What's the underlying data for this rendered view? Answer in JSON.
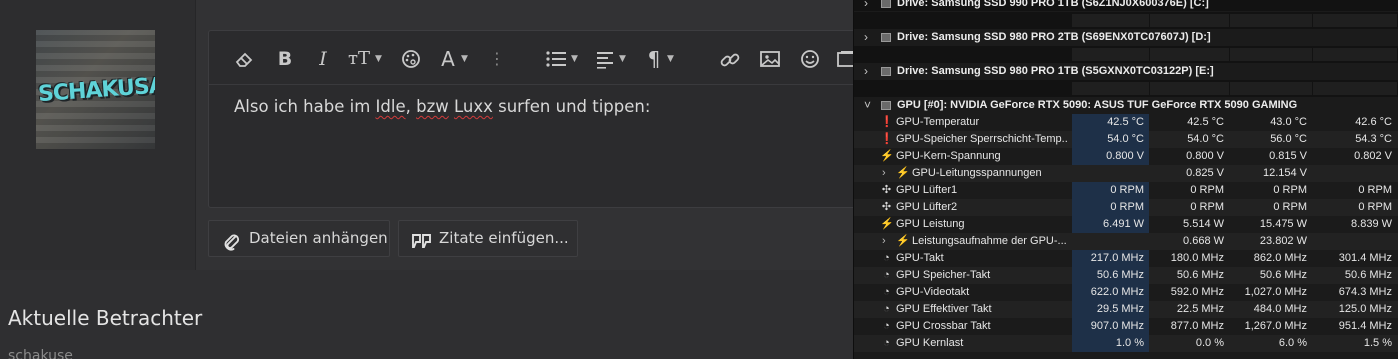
{
  "editor": {
    "text_before": "Also ich habe im ",
    "word_idle": "Idle",
    "text_mid1": ", ",
    "word_bzw": "bzw",
    "text_mid2": " ",
    "word_luxx": "Luxx",
    "text_after": " surfen und tippen:"
  },
  "avatar": {
    "graffiti_text": "SCHAKUSA"
  },
  "buttons": {
    "attach": "Dateien anhängen",
    "quote": "Zitate einfügen..."
  },
  "viewers": {
    "title": "Aktuelle Betrachter",
    "name": "schakuse"
  },
  "hwinfo": {
    "drives": [
      "Drive: Samsung SSD 990 PRO 1TB (S6Z1NJ0X600376E) [C:]",
      "Drive: Samsung SSD 980 PRO 2TB (S69ENX0TC07607J) [D:]",
      "Drive: Samsung SSD 980 PRO 1TB (S5GXNX0TC03122P) [E:]"
    ],
    "gpu_header": "GPU [#0]: NVIDIA GeForce RTX 5090: ASUS TUF GeForce RTX 5090 GAMING",
    "rows": [
      {
        "icon": "thermometer",
        "label": "GPU-Temperatur",
        "v": [
          "42.5 °C",
          "42.5 °C",
          "43.0 °C",
          "42.6 °C"
        ]
      },
      {
        "icon": "thermometer",
        "label": "GPU-Speicher Sperrschicht-Temp...",
        "v": [
          "54.0 °C",
          "54.0 °C",
          "56.0 °C",
          "54.3 °C"
        ]
      },
      {
        "icon": "lightning",
        "label": "GPU-Kern-Spannung",
        "v": [
          "0.800 V",
          "0.800 V",
          "0.815 V",
          "0.802 V"
        ]
      },
      {
        "icon": "lightning",
        "label": "GPU-Leitungsspannungen",
        "expand": true,
        "v": [
          "",
          "0.825 V",
          "12.154 V",
          ""
        ]
      },
      {
        "icon": "fan",
        "label": "GPU Lüfter1",
        "v": [
          "0 RPM",
          "0 RPM",
          "0 RPM",
          "0 RPM"
        ]
      },
      {
        "icon": "fan",
        "label": "GPU Lüfter2",
        "v": [
          "0 RPM",
          "0 RPM",
          "0 RPM",
          "0 RPM"
        ]
      },
      {
        "icon": "lightning",
        "label": "GPU Leistung",
        "v": [
          "6.491 W",
          "5.514 W",
          "15.475 W",
          "8.839 W"
        ]
      },
      {
        "icon": "lightning",
        "label": "Leistungsaufnahme der GPU-...",
        "expand": true,
        "v": [
          "",
          "0.668 W",
          "23.802 W",
          ""
        ]
      },
      {
        "icon": "clock",
        "label": "GPU-Takt",
        "v": [
          "217.0 MHz",
          "180.0 MHz",
          "862.0 MHz",
          "301.4 MHz"
        ]
      },
      {
        "icon": "clock",
        "label": "GPU Speicher-Takt",
        "v": [
          "50.6 MHz",
          "50.6 MHz",
          "50.6 MHz",
          "50.6 MHz"
        ]
      },
      {
        "icon": "clock",
        "label": "GPU-Videotakt",
        "v": [
          "622.0 MHz",
          "592.0 MHz",
          "1,027.0 MHz",
          "674.3 MHz"
        ]
      },
      {
        "icon": "clock",
        "label": "GPU Effektiver Takt",
        "v": [
          "29.5 MHz",
          "22.5 MHz",
          "484.0 MHz",
          "125.0 MHz"
        ]
      },
      {
        "icon": "clock",
        "label": "GPU Crossbar Takt",
        "v": [
          "907.0 MHz",
          "877.0 MHz",
          "1,267.0 MHz",
          "951.4 MHz"
        ]
      },
      {
        "icon": "clock",
        "label": "GPU Kernlast",
        "v": [
          "1.0 %",
          "0.0 %",
          "6.0 %",
          "1.5 %"
        ]
      }
    ]
  }
}
